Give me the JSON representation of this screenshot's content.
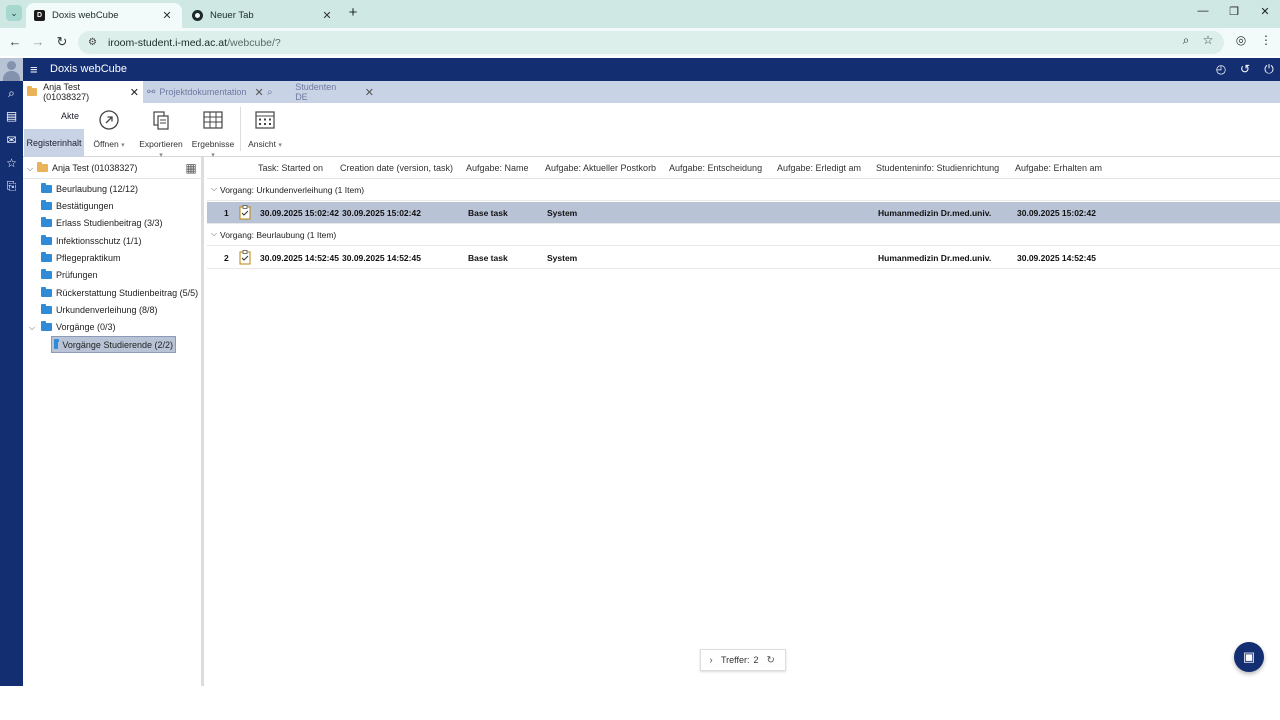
{
  "browser": {
    "tabs": [
      {
        "title": "Doxis webCube",
        "icon": "doxis-favicon"
      },
      {
        "title": "Neuer Tab",
        "icon": "chrome-favicon"
      }
    ],
    "url_host": "iroom-student.i-med.ac.at",
    "url_path": "/webcube/?"
  },
  "app": {
    "title": "Doxis webCube"
  },
  "doc_tabs": [
    {
      "label": "Anja Test (01038327)",
      "icon": "folder-icon"
    },
    {
      "label": "Projektdokumentation",
      "icon": "link-icon"
    },
    {
      "label": "Studenten DE",
      "icon": "search-icon"
    }
  ],
  "toolbar": {
    "akte": "Akte",
    "registerinhalt": "Registerinhalt",
    "open": "Öffnen",
    "export": "Exportieren",
    "results": "Ergebnisse",
    "view": "Ansicht"
  },
  "tree": {
    "root": "Anja Test (01038327)",
    "items": [
      "Beurlaubung (12/12)",
      "Bestätigungen",
      "Erlass Studienbeitrag (3/3)",
      "Infektionsschutz (1/1)",
      "Pflegepraktikum",
      "Prüfungen",
      "Rückerstattung Studienbeitrag (5/5)",
      "Urkundenverleihung (8/8)",
      "Vorgänge (0/3)"
    ],
    "child": "Vorgänge Studierende (2/2)"
  },
  "grid": {
    "columns": [
      "Task: Started on",
      "Creation date (version, task)",
      "Aufgabe: Name",
      "Aufgabe: Aktueller Postkorb",
      "Aufgabe: Entscheidung",
      "Aufgabe: Erledigt am",
      "Studenteninfo: Studienrichtung",
      "Aufgabe: Erhalten am"
    ],
    "groups": [
      {
        "label": "Vorgang: Urkundenverleihung (1 Item)",
        "row": {
          "num": "1",
          "started": "30.09.2025 15:02:42",
          "created": "30.09.2025 15:02:42",
          "name": "Base task",
          "postkorb": "System",
          "studienrichtung": "Humanmedizin Dr.med.univ.",
          "erhalten": "30.09.2025 15:02:42"
        }
      },
      {
        "label": "Vorgang: Beurlaubung (1 Item)",
        "row": {
          "num": "2",
          "started": "30.09.2025 14:52:45",
          "created": "30.09.2025 14:52:45",
          "name": "Base task",
          "postkorb": "System",
          "studienrichtung": "Humanmedizin Dr.med.univ.",
          "erhalten": "30.09.2025 14:52:45"
        }
      }
    ]
  },
  "footer": {
    "hits_label": "Treffer:",
    "hits_count": "2"
  },
  "colors": {
    "header": "#132f72",
    "selection": "#b9c3d6",
    "folder": "#2f8ad8"
  }
}
